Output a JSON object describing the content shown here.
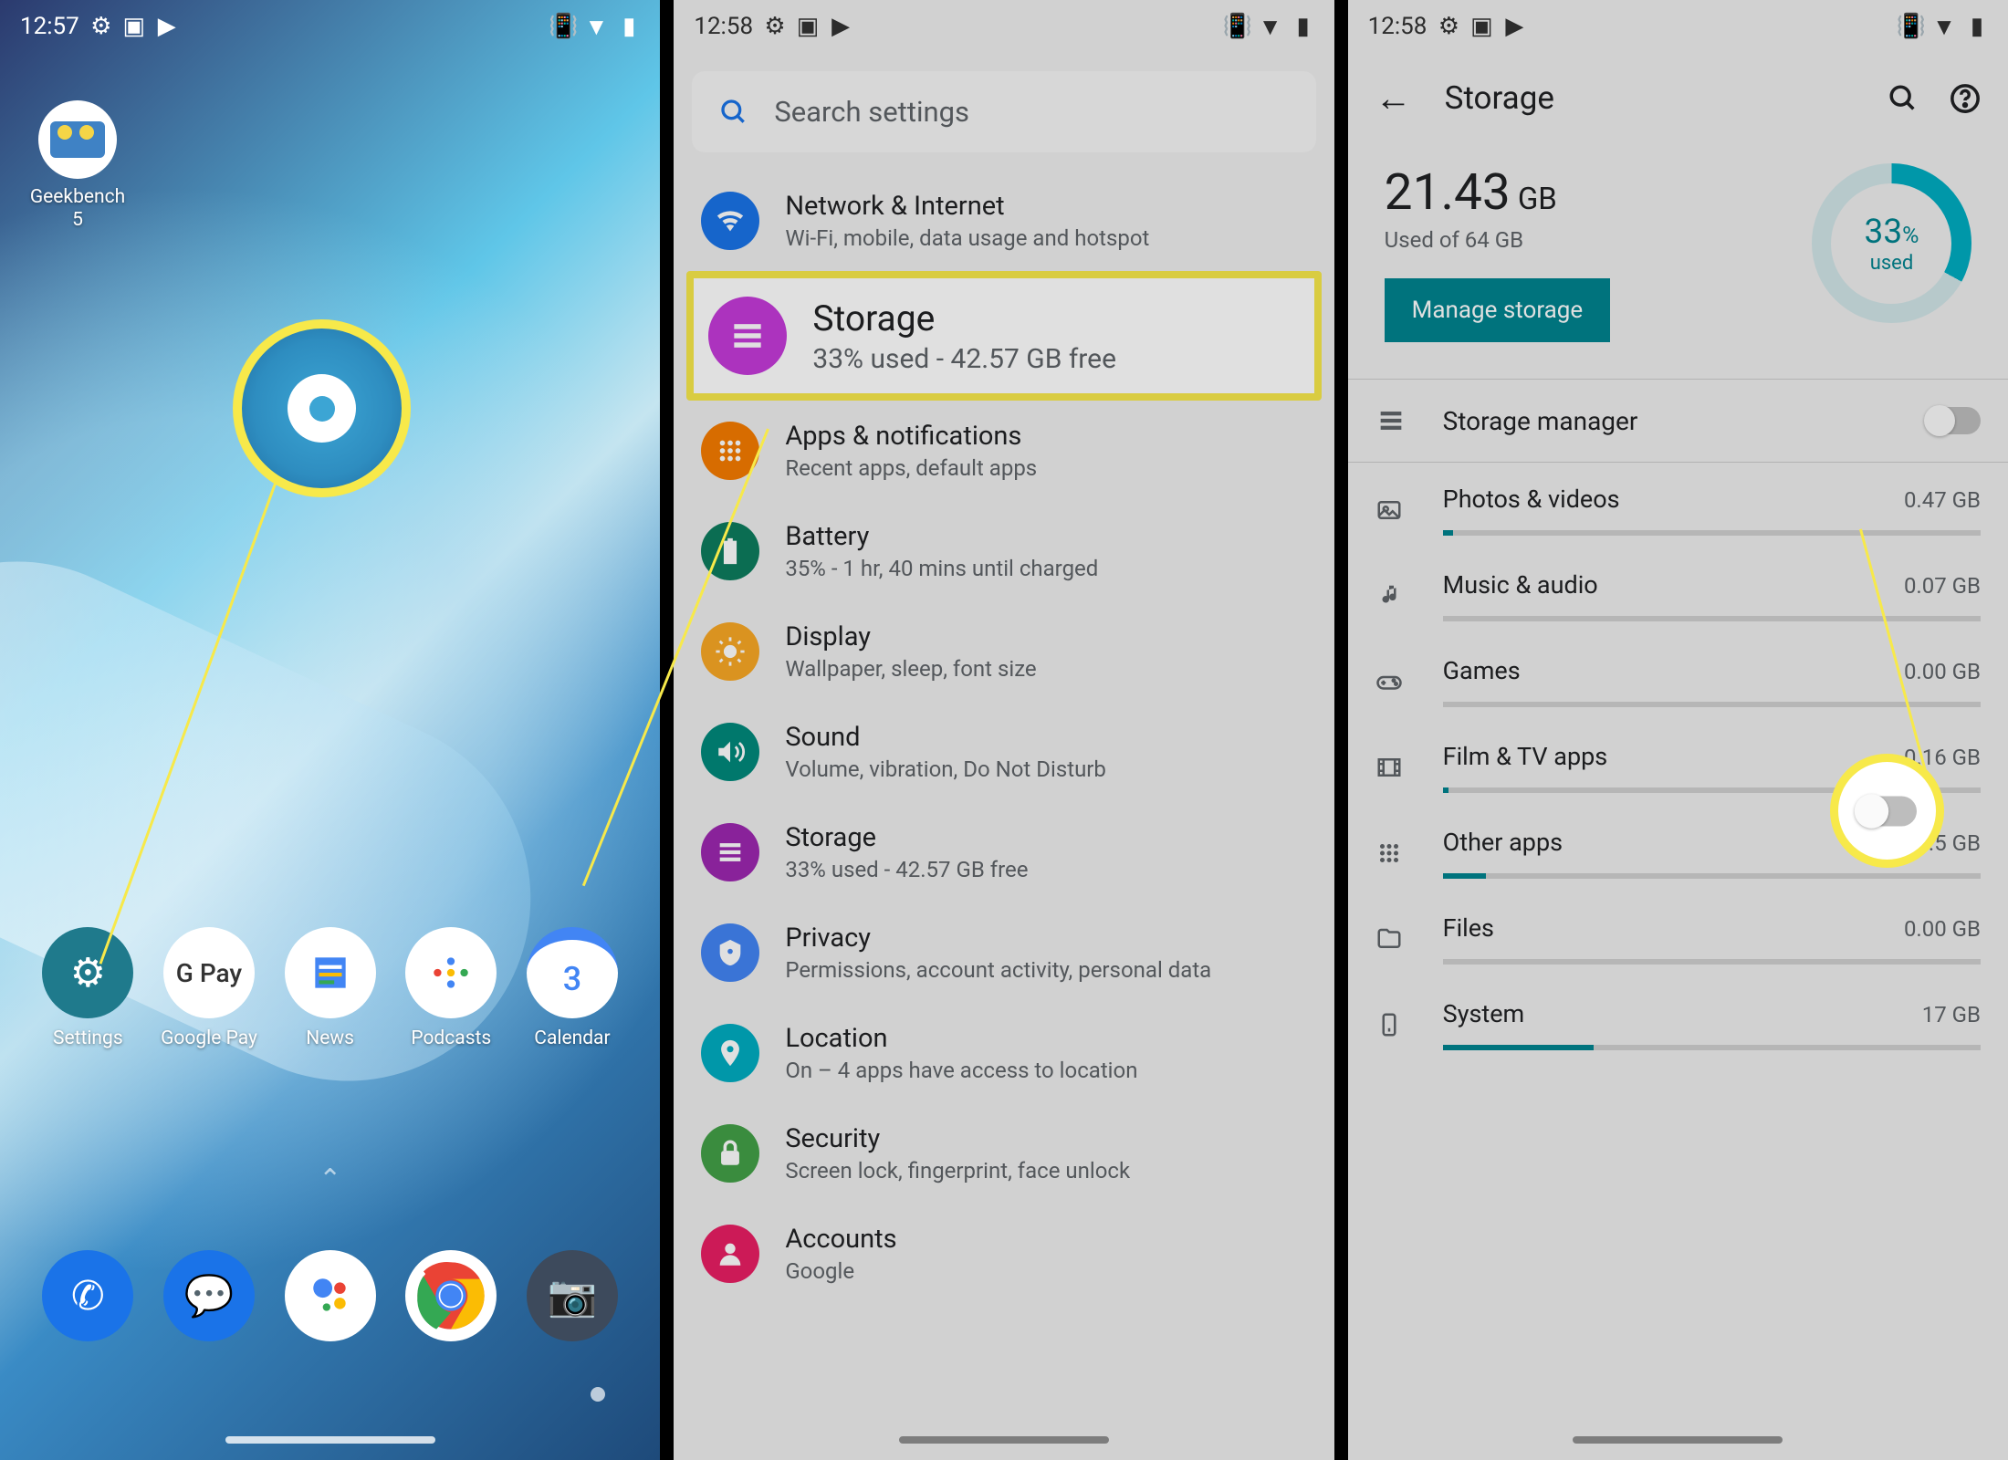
{
  "statusbar": {
    "time1": "12:57",
    "time2": "12:58",
    "time3": "12:58"
  },
  "home": {
    "geekbench": "Geekbench 5",
    "dock": {
      "settings": "Settings",
      "gpay": "Google Pay",
      "news": "News",
      "podcasts": "Podcasts",
      "calendar": "Calendar",
      "calendar_num": "3",
      "gpay_text": "G Pay"
    }
  },
  "search": {
    "placeholder": "Search settings"
  },
  "settings_list": {
    "network": {
      "title": "Network & Internet",
      "sub": "Wi-Fi, mobile, data usage and hotspot"
    },
    "storage_hl": {
      "title": "Storage",
      "sub": "33% used - 42.57 GB free"
    },
    "apps": {
      "title": "Apps & notifications",
      "sub": "Recent apps, default apps"
    },
    "battery": {
      "title": "Battery",
      "sub": "35% - 1 hr, 40 mins until charged"
    },
    "display": {
      "title": "Display",
      "sub": "Wallpaper, sleep, font size"
    },
    "sound": {
      "title": "Sound",
      "sub": "Volume, vibration, Do Not Disturb"
    },
    "storage": {
      "title": "Storage",
      "sub": "33% used - 42.57 GB free"
    },
    "privacy": {
      "title": "Privacy",
      "sub": "Permissions, account activity, personal data"
    },
    "location": {
      "title": "Location",
      "sub": "On – 4 apps have access to location"
    },
    "security": {
      "title": "Security",
      "sub": "Screen lock, fingerprint, face unlock"
    },
    "accounts": {
      "title": "Accounts",
      "sub": "Google"
    }
  },
  "storage_page": {
    "title": "Storage",
    "used_value": "21.43",
    "used_unit": "GB",
    "total": "Used of 64 GB",
    "manage_btn": "Manage storage",
    "percent": "33",
    "percent_sym": "%",
    "used_label": "used",
    "storage_manager": "Storage manager",
    "categories": [
      {
        "name": "Photos & videos",
        "size": "0.47 GB",
        "fill": 2
      },
      {
        "name": "Music & audio",
        "size": "0.07 GB",
        "fill": 0
      },
      {
        "name": "Games",
        "size": "0.00 GB",
        "fill": 0
      },
      {
        "name": "Film & TV apps",
        "size": "0.16 GB",
        "fill": 1
      },
      {
        "name": "Other apps",
        "size": "3.5 GB",
        "fill": 8
      },
      {
        "name": "Files",
        "size": "0.00 GB",
        "fill": 0
      },
      {
        "name": "System",
        "size": "17 GB",
        "fill": 28
      }
    ]
  }
}
